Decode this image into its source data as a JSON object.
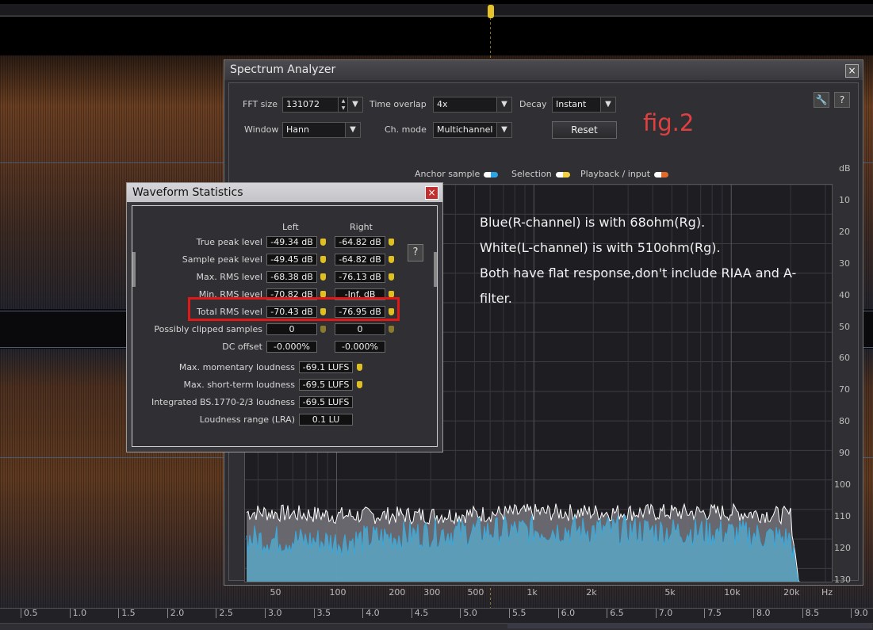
{
  "spectrum": {
    "title": "Spectrum Analyzer",
    "close": "×",
    "fft_size_label": "FFT size",
    "fft_size_value": "131072",
    "time_overlap_label": "Time overlap",
    "time_overlap_value": "4x",
    "decay_label": "Decay",
    "decay_value": "Instant",
    "window_label": "Window",
    "window_value": "Hann",
    "ch_mode_label": "Ch. mode",
    "ch_mode_value": "Multichannel",
    "reset_label": "Reset",
    "fig_label": "fig.2",
    "settings_icon": "wrench-icon",
    "help_label": "?",
    "legend": {
      "anchor": "Anchor sample",
      "selection": "Selection",
      "playback": "Playback / input",
      "anchor_color": "#2aa6e8",
      "selection_color": "#f0d040",
      "playback_color": "#e06a2a"
    },
    "y_axis": [
      "dB",
      "10",
      "20",
      "30",
      "40",
      "50",
      "60",
      "70",
      "80",
      "90",
      "100",
      "110",
      "120",
      "130"
    ],
    "x_axis": [
      "50",
      "100",
      "200",
      "300",
      "500",
      "1k",
      "2k",
      "5k",
      "10k",
      "20k",
      "Hz"
    ],
    "annotation": [
      "Blue(R-channel) is with 68ohm(Rg).",
      "White(L-channel) is with 510ohm(Rg).",
      "Both have flat response,don't include RIAA and A-filter."
    ]
  },
  "chart_data": {
    "type": "area",
    "title": "",
    "xlabel": "Hz",
    "ylabel": "dB",
    "x_scale": "log",
    "xlim": [
      35,
      30000
    ],
    "ylim": [
      -135,
      0
    ],
    "grid": true,
    "series": [
      {
        "name": "White(L-channel)",
        "color": "#ffffff",
        "x": [
          40,
          100,
          300,
          1000,
          3000,
          10000,
          20000,
          22000,
          30000
        ],
        "y": [
          -111,
          -112,
          -112,
          -111,
          -111,
          -111,
          -112,
          -135,
          -135
        ]
      },
      {
        "name": "Blue(R-channel)",
        "color": "#3aa8dc",
        "x": [
          40,
          100,
          300,
          1000,
          3000,
          10000,
          20000,
          22000,
          30000
        ],
        "y": [
          -121,
          -122,
          -119,
          -118,
          -118,
          -119,
          -121,
          -135,
          -135
        ]
      }
    ]
  },
  "stats": {
    "title": "Waveform Statistics",
    "close": "×",
    "help": "?",
    "col_left": "Left",
    "col_right": "Right",
    "rows": [
      {
        "label": "True peak level",
        "left": "-49.34 dB",
        "right": "-64.82 dB"
      },
      {
        "label": "Sample peak level",
        "left": "-49.45 dB",
        "right": "-64.82 dB"
      },
      {
        "label": "Max. RMS level",
        "left": "-68.38 dB",
        "right": "-76.13 dB"
      },
      {
        "label": "Min. RMS level",
        "left": "-70.82 dB",
        "right": "-Inf. dB"
      },
      {
        "label": "Total RMS level",
        "left": "-70.43 dB",
        "right": "-76.95 dB"
      },
      {
        "label": "Possibly clipped samples",
        "left": "0",
        "right": "0"
      },
      {
        "label": "DC offset",
        "left": "-0.000%",
        "right": "-0.000%"
      }
    ],
    "loudness": [
      {
        "label": "Max. momentary loudness",
        "value": "-69.1 LUFS"
      },
      {
        "label": "Max. short-term loudness",
        "value": "-69.5 LUFS"
      },
      {
        "label": "Integrated BS.1770-2/3 loudness",
        "value": "-69.5 LUFS"
      },
      {
        "label": "Loudness range (LRA)",
        "value": "0.1 LU"
      }
    ]
  },
  "timeline": [
    "0.5",
    "1.0",
    "1.5",
    "2.0",
    "2.5",
    "3.0",
    "3.5",
    "4.0",
    "4.5",
    "5.0",
    "5.5",
    "6.0",
    "6.5",
    "7.0",
    "7.5",
    "8.0",
    "8.5",
    "9.0"
  ]
}
